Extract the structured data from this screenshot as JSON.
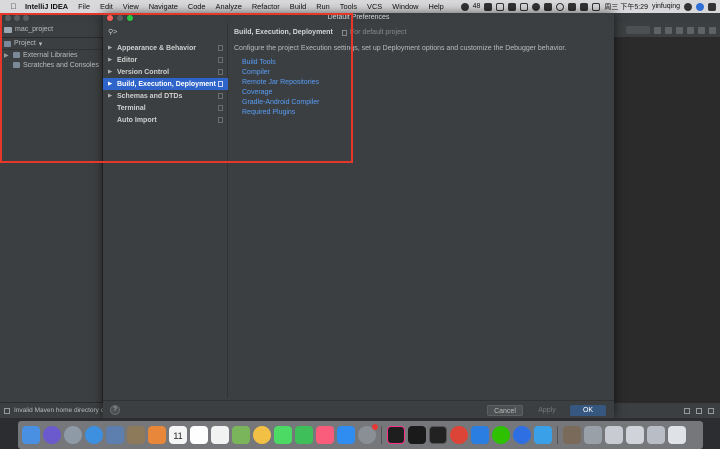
{
  "menubar": {
    "app_name": "IntelliJ IDEA",
    "items": [
      "File",
      "Edit",
      "View",
      "Navigate",
      "Code",
      "Analyze",
      "Refactor",
      "Build",
      "Run",
      "Tools",
      "VCS",
      "Window",
      "Help"
    ],
    "battery_count": "48",
    "datetime": "周三 下午5:29",
    "username": "yinfuqing"
  },
  "ide": {
    "project_path": "mac_project",
    "project_view_label": "Project",
    "tree": [
      {
        "label": "External Libraries",
        "icon": "library-icon",
        "expandable": true
      },
      {
        "label": "Scratches and Consoles",
        "icon": "scratches-icon",
        "expandable": false
      }
    ],
    "status_message": "Invalid Maven home directory con"
  },
  "dialog": {
    "title": "Default Preferences",
    "search_placeholder": "",
    "nav_items": [
      {
        "label": "Appearance & Behavior",
        "has_arrow": true,
        "selected": false
      },
      {
        "label": "Editor",
        "has_arrow": true,
        "selected": false
      },
      {
        "label": "Version Control",
        "has_arrow": true,
        "selected": false
      },
      {
        "label": "Build, Execution, Deployment",
        "has_arrow": true,
        "selected": true
      },
      {
        "label": "Schemas and DTDs",
        "has_arrow": true,
        "selected": false
      },
      {
        "label": "Terminal",
        "has_arrow": false,
        "selected": false
      },
      {
        "label": "Auto Import",
        "has_arrow": false,
        "selected": false
      }
    ],
    "content": {
      "breadcrumb": "Build, Execution, Deployment",
      "scope": "For default project",
      "description": "Configure the project Execution settings, set up Deployment options and customize the Debugger behavior.",
      "links": [
        "Build Tools",
        "Compiler",
        "Remote Jar Repositories",
        "Coverage",
        "Gradle-Android Compiler",
        "Required Plugins"
      ]
    },
    "buttons": {
      "help": "?",
      "cancel": "Cancel",
      "apply": "Apply",
      "ok": "OK"
    }
  },
  "colors": {
    "accent": "#2f65ca",
    "link": "#589df6",
    "highlight_box": "#e5382a"
  },
  "dock": {
    "icons": [
      "finder-icon",
      "siri-icon",
      "launchpad-icon",
      "safari-icon",
      "preview-icon",
      "photos-viewer-icon",
      "books-icon",
      "calendar-icon",
      "notes-icon",
      "reminders-icon",
      "maps-icon",
      "photos-icon",
      "messages-icon",
      "facetime-icon",
      "music-icon",
      "app-store-icon",
      "system-preferences-icon",
      "intellij-icon",
      "terminal-icon",
      "terminal-2-icon",
      "chrome-icon",
      "vpn-icon",
      "wechat-icon",
      "maps-pin-icon",
      "paper-plane-icon",
      "sublime-icon",
      "screenshot-icon",
      "keyboard-viewer-icon",
      "finder-window-icon",
      "minimized-window-icon",
      "trash-icon"
    ],
    "calendar_day": "11"
  }
}
